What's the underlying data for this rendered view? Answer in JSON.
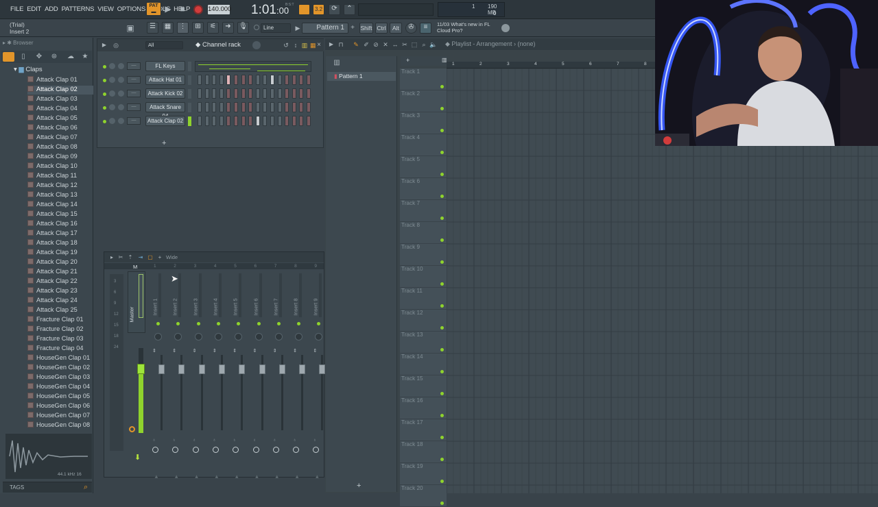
{
  "menu": [
    "FILE",
    "EDIT",
    "ADD",
    "PATTERNS",
    "VIEW",
    "OPTIONS",
    "TOOLS",
    "HELP"
  ],
  "hint": {
    "line1": "(Trial)",
    "line2": "Insert 2"
  },
  "transport": {
    "pat_label": "PAT",
    "tempo": "140.000",
    "time": "1:01",
    "time_sub": ":00",
    "beat_label": "B:S:T",
    "cpu": "1",
    "mem": "190 MB",
    "voices": "0"
  },
  "toolbar": {
    "snap": "Line",
    "pattern": "Pattern 1",
    "shift": "Shift",
    "ctrl": "Ctrl",
    "alt": "Alt",
    "news_date": "11/03",
    "news_text": "What's new in FL Cloud Pro?"
  },
  "browser": {
    "title": "Browser",
    "folder": "Claps",
    "items": [
      "Attack Clap 01",
      "Attack Clap 02",
      "Attack Clap 03",
      "Attack Clap 04",
      "Attack Clap 05",
      "Attack Clap 06",
      "Attack Clap 07",
      "Attack Clap 08",
      "Attack Clap 09",
      "Attack Clap 10",
      "Attack Clap 11",
      "Attack Clap 12",
      "Attack Clap 13",
      "Attack Clap 14",
      "Attack Clap 15",
      "Attack Clap 16",
      "Attack Clap 17",
      "Attack Clap 18",
      "Attack Clap 19",
      "Attack Clap 20",
      "Attack Clap 21",
      "Attack Clap 22",
      "Attack Clap 23",
      "Attack Clap 24",
      "Attack Clap 25",
      "Fracture Clap 01",
      "Fracture Clap 02",
      "Fracture Clap 03",
      "Fracture Clap 04",
      "HouseGen Clap 01",
      "HouseGen Clap 02",
      "HouseGen Clap 03",
      "HouseGen Clap 04",
      "HouseGen Clap 05",
      "HouseGen Clap 06",
      "HouseGen Clap 07",
      "HouseGen Clap 08"
    ],
    "selected_index": 1,
    "sample_info": "44.1 kHz 16",
    "tags": "TAGS"
  },
  "channel_rack": {
    "filter": "All",
    "title": "Channel rack",
    "channels": [
      "FL Keys",
      "Attack Hat 01",
      "Attack Kick 02",
      "Attack Snare 04",
      "Attack Clap 02"
    ],
    "add": "+"
  },
  "mixer": {
    "view": "Wide",
    "master": "Master",
    "master_tag": "M",
    "inserts": [
      "Insert 1",
      "Insert 2",
      "Insert 3",
      "Insert 4",
      "Insert 5",
      "Insert 6",
      "Insert 7",
      "Insert 8",
      "Insert 9"
    ],
    "insert_numbers": [
      "1",
      "2",
      "3",
      "4",
      "5",
      "6",
      "7",
      "8",
      "9"
    ],
    "scale": [
      "3",
      "6",
      "9",
      "12",
      "15",
      "18",
      "24"
    ]
  },
  "playlist": {
    "title": "Playlist - Arrangement",
    "pattern_sel": "(none)",
    "pattern_item": "Pattern 1",
    "bars": [
      "1",
      "2",
      "3",
      "4",
      "5",
      "6",
      "7",
      "8"
    ],
    "tracks": [
      "Track 1",
      "Track 2",
      "Track 3",
      "Track 4",
      "Track 5",
      "Track 6",
      "Track 7",
      "Track 8",
      "Track 9",
      "Track 10",
      "Track 11",
      "Track 12",
      "Track 13",
      "Track 14",
      "Track 15",
      "Track 16",
      "Track 17",
      "Track 18",
      "Track 19",
      "Track 20"
    ],
    "add": "+"
  },
  "colors": {
    "accent": "#8fd32d",
    "orange": "#e2952a",
    "record": "#d23c3c"
  }
}
